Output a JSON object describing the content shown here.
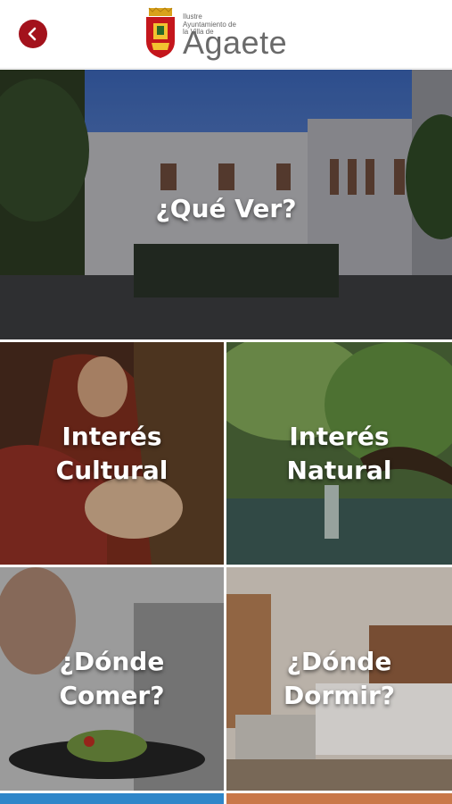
{
  "header": {
    "back_icon": "chevron-left-icon",
    "brand_color": "#a3121c",
    "logo_small_text": "Ilustre\nAyuntamiento de\nla Villa de",
    "logo_main_text": "Agaete"
  },
  "tiles": {
    "que_ver": {
      "label": "¿Qué Ver?"
    },
    "interes_cultural": {
      "label": "Interés\nCultural"
    },
    "interes_natural": {
      "label": "Interés\nNatural"
    },
    "donde_comer": {
      "label": "¿Dónde\nComer?"
    },
    "donde_dormir": {
      "label": "¿Dónde\nDormir?"
    }
  }
}
